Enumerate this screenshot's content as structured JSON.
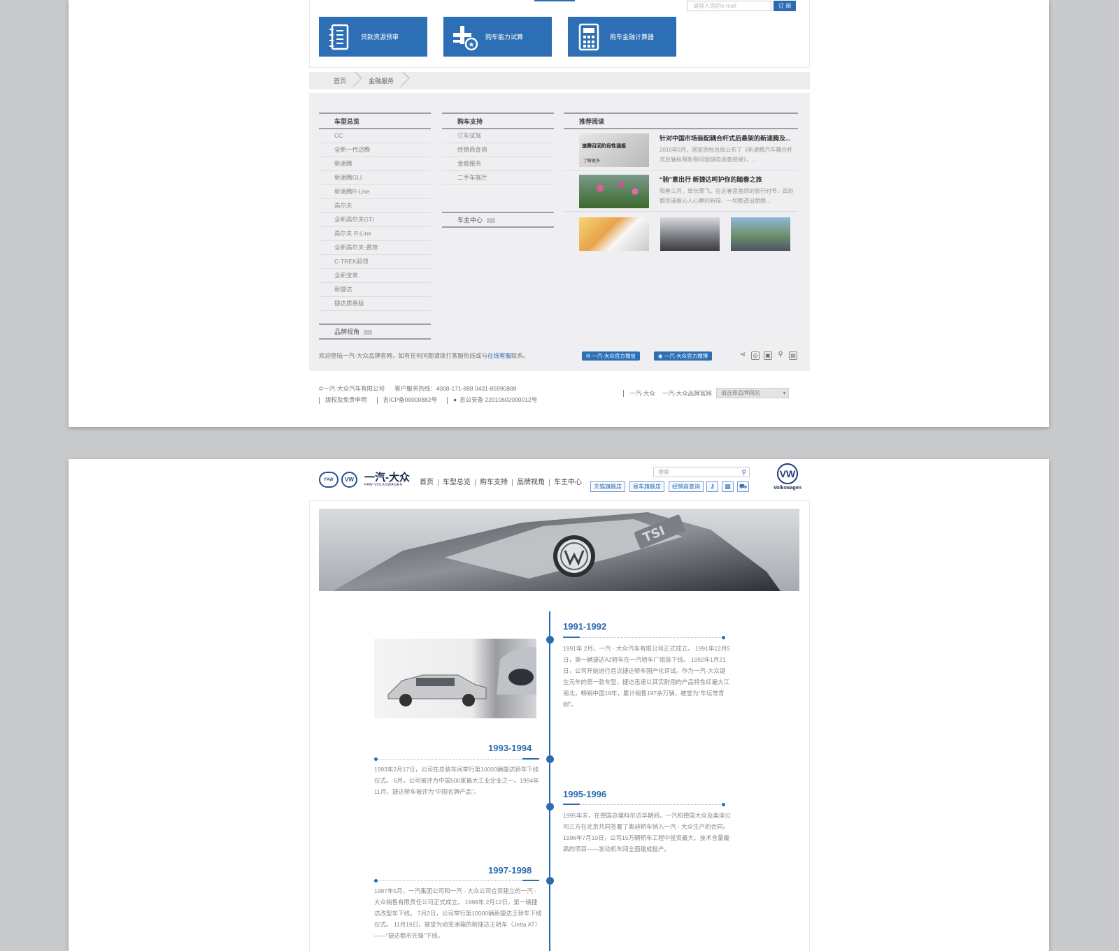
{
  "board1": {
    "subscribe": {
      "placeholder": "请输入您的e-mail",
      "button": "订 阅"
    },
    "tools": [
      {
        "label": "贷款资源预审",
        "icon": "document-list-icon"
      },
      {
        "label": "购车能力试算",
        "icon": "calculator-plus-icon"
      },
      {
        "label": "购车金融计算器",
        "icon": "calculator-icon"
      }
    ],
    "breadcrumb": [
      "首页",
      "金融服务"
    ],
    "columns": {
      "models": {
        "title": "车型总览",
        "items": [
          "CC",
          "全新一代迈腾",
          "新速腾",
          "新速腾GLI",
          "新速腾R-Line",
          "高尔夫",
          "全新高尔夫GTI",
          "高尔夫 R-Line",
          "全新高尔夫·嘉旅",
          "C-TREK蔚领",
          "全新宝来",
          "新捷达",
          "捷达质惠版"
        ],
        "sub": "品牌视角"
      },
      "support": {
        "title": "购车支持",
        "items": [
          "订车试驾",
          "经销商查询",
          "金融服务",
          "二手车展厅"
        ],
        "sub": "车主中心"
      }
    },
    "recommended": {
      "title": "推荐阅读",
      "items": [
        {
          "title": "针对中国市场装配耦合杆式后悬架的新速腾及...",
          "desc": "2015年9月，国家质检总局公布了《新速腾汽车耦合杆式后轴纵臂断裂问题缺陷调查结果》，...",
          "thumb_text": "速腾召回阶段性通报",
          "thumb_sub": "了解更多"
        },
        {
          "title": "“驰”意出行 新捷达呵护你的踏春之旅",
          "desc": "阳春三月，草长莺飞，在这春意盎然的旅行时节，四处都弥漫着沁人心脾的新绿，一切都透出朗朗..."
        }
      ]
    },
    "notice": {
      "text": "欢迎登陆一汽-大众品牌官网，如有任何问题请拨打客服热线或与",
      "link": "在线客服",
      "suffix": "联系。"
    },
    "social_buttons": [
      "一汽-大众官方微信",
      "一汽-大众官方微博"
    ],
    "footer": {
      "copyright": "©一汽-大众汽车有限公司",
      "hotline": "客户服务热线：4008-171-888    0431-85990888",
      "disclaimer": "版权及免责申明",
      "icp": "吉ICP备09000882号",
      "police": "吉公安备 22010602000012号",
      "links": [
        "一汽-大众",
        "一汽-大众品牌官网"
      ],
      "select": "请选择品牌网站"
    }
  },
  "board2": {
    "logo": {
      "cn": "一汽-大众",
      "en": "FAW-VOLKSWAGEN",
      "mark1": "FAW",
      "mark2": "VW"
    },
    "nav": [
      "首页",
      "车型总览",
      "购车支持",
      "品牌视角",
      "车主中心"
    ],
    "search_placeholder": "搜索",
    "quick_links": [
      "天猫旗舰店",
      "易车旗舰店",
      "经销商查询"
    ],
    "vw_brand": "Volkswagen",
    "timeline": [
      {
        "years": "1991-1992",
        "text": "1991年 2月，一汽 - 大众汽车有限公司正式成立。 1991年12月5日，第一辆捷达A2轿车在一汽轿车厂组装下线。 1992年1月21日，公司开始进行首次捷达轿车国产化评试。作为一汽-大众诞生元年的第一款车型，捷达迅速以其实耐用的产品特性红遍大江南北，畅销中国19年，累计销售197余万辆，被誉为“车坛常青树”。"
      },
      {
        "years": "1993-1994",
        "text": "1993年2月17日，公司在总装车间举行第10000辆捷达轿车下线仪式。 6月，公司被评为中国500家最大工业企业之一。1994年11月，捷达轿车被评为“中国名牌产品”。"
      },
      {
        "years": "1995-1996",
        "text": "1995年末，在德国总理科尔访华期间，一汽和德国大众及奥迪公司三方在北京共同签署了奥迪轿车纳入一汽 - 大众生产的合同。 1996年7月10日，公司15万辆轿车工程中投资最大、技术含量最高的项目——发动机车间全面建成投产。"
      },
      {
        "years": "1997-1998",
        "text": "1997年5月，一汽集团公司和一汽 - 大众公司合资建立的一汽 - 大众销售有限责任公司正式成立。 1998年 2月12日，第一辆捷达改型车下线。 7月2日，公司举行第10000辆新捷达王轿车下线仪式。 11月19日，被誉为动变速箱的新捷达王轿车（Jetta AT）——“捷达都市先锋”下线。"
      }
    ]
  }
}
